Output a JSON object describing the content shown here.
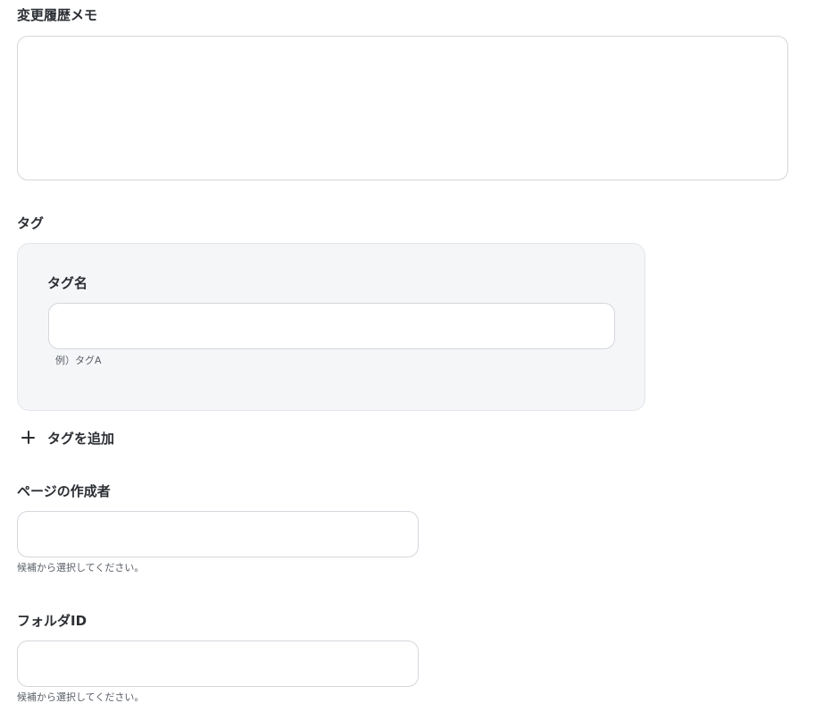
{
  "change_memo": {
    "label": "変更履歴メモ",
    "value": ""
  },
  "tags": {
    "label": "タグ",
    "tag_name_label": "タグ名",
    "tag_name_value": "",
    "tag_name_hint": "例）タグA",
    "add_tag_label": "タグを追加",
    "add_icon": "plus-icon"
  },
  "page_author": {
    "label": "ページの作成者",
    "value": "",
    "hint": "候補から選択してください。"
  },
  "folder_id": {
    "label": "フォルダID",
    "value": "",
    "hint": "候補から選択してください。"
  }
}
